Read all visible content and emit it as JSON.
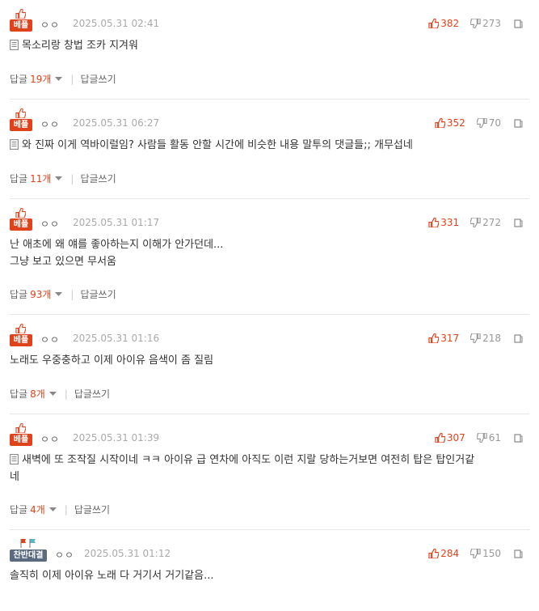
{
  "comments": [
    {
      "badge": "베플",
      "nick": "ㅇㅇ",
      "date": "2025.05.31 02:41",
      "up": "382",
      "down": "273",
      "doc_icon": true,
      "lines": [
        "목소리랑 창법 조카 지겨워"
      ],
      "reply_label": "답글",
      "reply_count": "19개",
      "write_label": "답글쓰기"
    },
    {
      "badge": "베플",
      "nick": "ㅇㅇ",
      "date": "2025.05.31 06:27",
      "up": "352",
      "down": "70",
      "doc_icon": true,
      "lines": [
        "와 진짜 이게 역바이럴임? 사람들 활동 안할 시간에 비슷한 내용 말투의 댓글들;; 개무섭네"
      ],
      "reply_label": "답글",
      "reply_count": "11개",
      "write_label": "답글쓰기"
    },
    {
      "badge": "베플",
      "nick": "ㅇㅇ",
      "date": "2025.05.31 01:17",
      "up": "331",
      "down": "272",
      "doc_icon": false,
      "lines": [
        "난 애초에 왜 얘를 좋아하는지 이해가 안가던데...",
        "그냥 보고 있으면 무서움"
      ],
      "reply_label": "답글",
      "reply_count": "93개",
      "write_label": "답글쓰기"
    },
    {
      "badge": "베플",
      "nick": "ㅇㅇ",
      "date": "2025.05.31 01:16",
      "up": "317",
      "down": "218",
      "doc_icon": false,
      "lines": [
        "노래도 우중충하고 이제 아이유 음색이 좀 질림"
      ],
      "reply_label": "답글",
      "reply_count": "8개",
      "write_label": "답글쓰기"
    },
    {
      "badge": "베플",
      "nick": "ㅇㅇ",
      "date": "2025.05.31 01:39",
      "up": "307",
      "down": "61",
      "doc_icon": true,
      "lines": [
        "새벽에 또 조작질 시작이네 ㅋㅋ 아이유 급 연차에 아직도 이런 지랄 당하는거보면 여전히 탑은 탑인거같",
        "네"
      ],
      "reply_label": "답글",
      "reply_count": "4개",
      "write_label": "답글쓰기"
    },
    {
      "badge": "찬반대결",
      "nick": "ㅇㅇ",
      "date": "2025.05.31 01:12",
      "up": "284",
      "down": "150",
      "doc_icon": false,
      "lines": [
        "솔직히 이제 아이유 노래 다 거기서 거기같음..."
      ]
    }
  ],
  "colors": {
    "accent": "#e0431c",
    "badge_blue": "#5a6b80",
    "muted": "#aaaaaa"
  }
}
